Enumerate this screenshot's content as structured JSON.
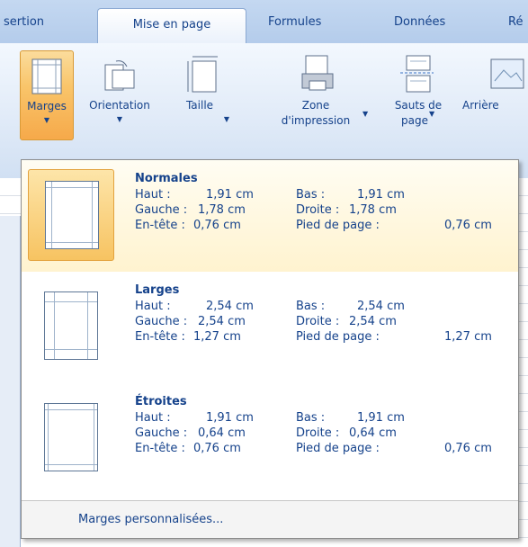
{
  "tabs": {
    "insertion": "sertion",
    "mise_en_page": "Mise en page",
    "formules": "Formules",
    "donnees": "Données",
    "revision": "Ré"
  },
  "ribbon": {
    "marges": "Marges",
    "orientation": "Orientation",
    "taille": "Taille",
    "zone_line1": "Zone",
    "zone_line2": "d'impression",
    "sauts_line1": "Sauts de",
    "sauts_line2": "page",
    "arriere": "Arrière"
  },
  "margins": [
    {
      "title": "Normales",
      "haut_label": "Haut :",
      "haut_value": "1,91 cm",
      "bas_label": "Bas :",
      "bas_value": "1,91 cm",
      "gauche_label": "Gauche :",
      "gauche_value": "1,78 cm",
      "droite_label": "Droite :",
      "droite_value": "1,78 cm",
      "entete_label": "En-tête :",
      "entete_value": "0,76 cm",
      "pied_label": "Pied de page :",
      "pied_value": "0,76 cm"
    },
    {
      "title": "Larges",
      "haut_label": "Haut :",
      "haut_value": "2,54 cm",
      "bas_label": "Bas :",
      "bas_value": "2,54 cm",
      "gauche_label": "Gauche :",
      "gauche_value": "2,54 cm",
      "droite_label": "Droite :",
      "droite_value": "2,54 cm",
      "entete_label": "En-tête :",
      "entete_value": "1,27 cm",
      "pied_label": "Pied de page :",
      "pied_value": "1,27 cm"
    },
    {
      "title": "Étroites",
      "haut_label": "Haut :",
      "haut_value": "1,91 cm",
      "bas_label": "Bas :",
      "bas_value": "1,91 cm",
      "gauche_label": "Gauche :",
      "gauche_value": "0,64 cm",
      "droite_label": "Droite :",
      "droite_value": "0,64 cm",
      "entete_label": "En-tête :",
      "entete_value": "0,76 cm",
      "pied_label": "Pied de page :",
      "pied_value": "0,76 cm"
    }
  ],
  "custom_label": "Marges personnalisées...",
  "colors": {
    "accent": "#15428b",
    "highlight": "#f7c361"
  }
}
